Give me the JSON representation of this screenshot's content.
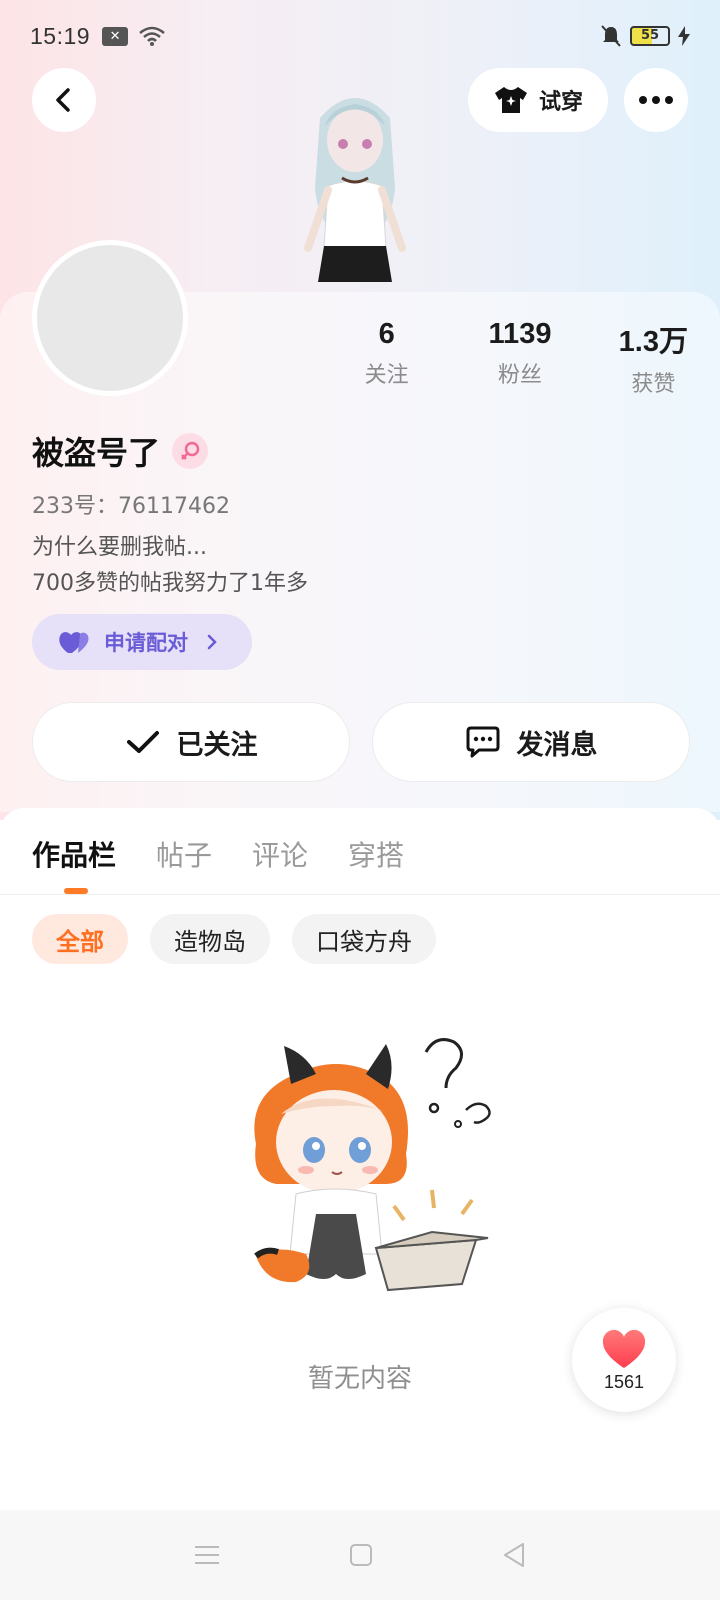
{
  "status_bar": {
    "time": "15:19",
    "battery": "55"
  },
  "header": {
    "try_on_label": "试穿"
  },
  "profile": {
    "name": "被盗号了",
    "uid": "233号：76117462",
    "bio_line1": "为什么要删我帖...",
    "bio_line2": "700多赞的帖我努力了1年多",
    "match_label": "申请配对",
    "stats": [
      {
        "num": "6",
        "label": "关注"
      },
      {
        "num": "1139",
        "label": "粉丝"
      },
      {
        "num": "1.3万",
        "label": "获赞"
      }
    ],
    "follow_label": "已关注",
    "message_label": "发消息"
  },
  "tabs": [
    "作品栏",
    "帖子",
    "评论",
    "穿搭"
  ],
  "chips": [
    "全部",
    "造物岛",
    "口袋方舟"
  ],
  "empty_text": "暂无内容",
  "like_count": "1561",
  "colors": {
    "accent": "#ff7a26",
    "match": "#6a5bd6",
    "like": "#ff4d5a"
  }
}
